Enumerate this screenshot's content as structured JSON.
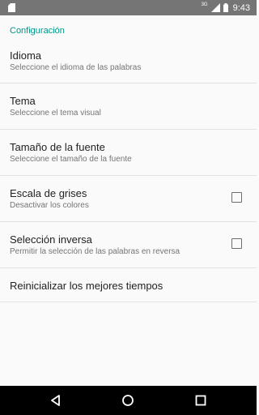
{
  "status_bar": {
    "notification_icon": "sd-card-icon",
    "network": "3G",
    "time": "9:43"
  },
  "settings": {
    "section_title": "Configuración",
    "items": [
      {
        "title": "Idioma",
        "summary": "Seleccione el idioma de las palabras"
      },
      {
        "title": "Tema",
        "summary": "Seleccione el tema visual"
      },
      {
        "title": "Tamaño de la fuente",
        "summary": "Seleccione el tamaño de la fuente"
      },
      {
        "title": "Escala de grises",
        "summary": "Desactivar los colores",
        "checked": false
      },
      {
        "title": "Selección inversa",
        "summary": "Permitir la selección de las palabras en reversa",
        "checked": false
      },
      {
        "title": "Reinicializar los mejores tiempos"
      }
    ]
  },
  "nav_bar": {
    "buttons": [
      "back-icon",
      "home-icon",
      "recents-icon"
    ]
  },
  "colors": {
    "accent": "#009688",
    "status_bar": "#757575",
    "nav_bar": "#000000",
    "background": "#fafafa"
  }
}
